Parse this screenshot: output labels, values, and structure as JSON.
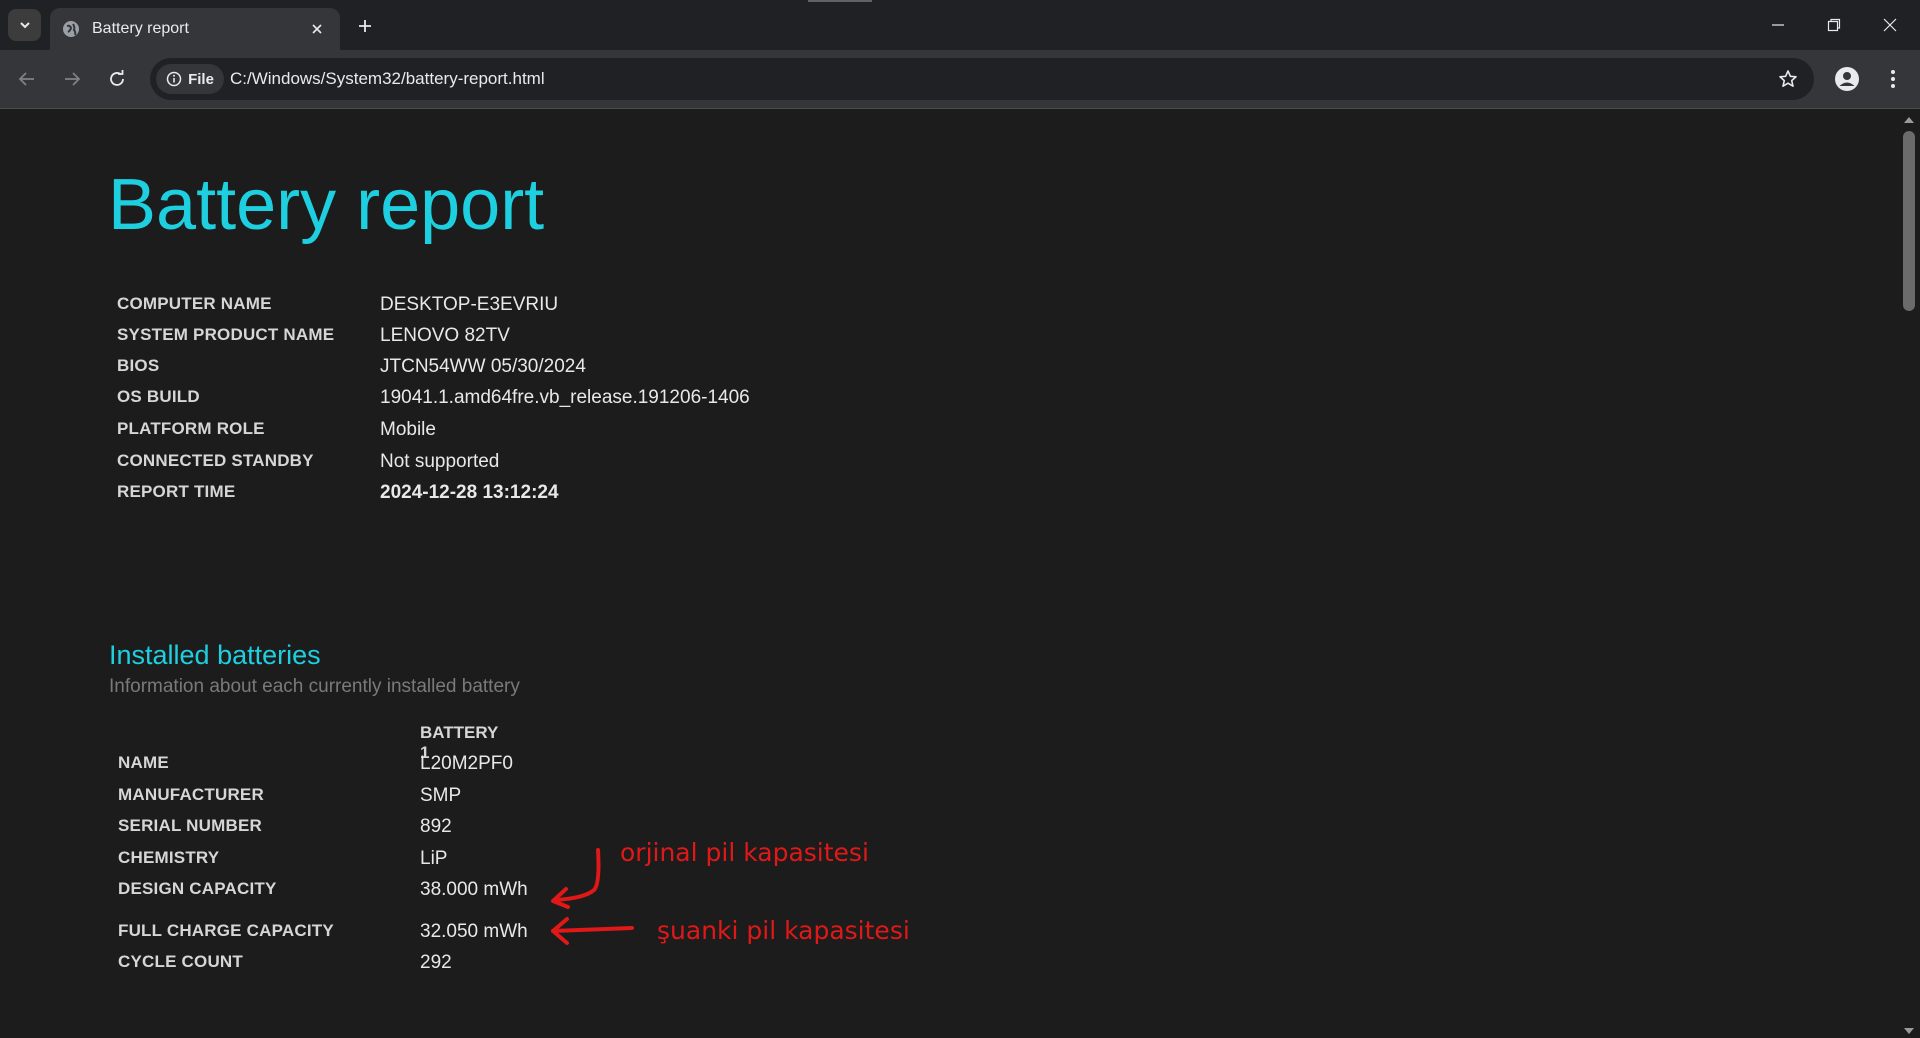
{
  "browser": {
    "tab_title": "Battery report",
    "url": "C:/Windows/System32/battery-report.html",
    "chip_label": "File"
  },
  "report": {
    "title": "Battery report",
    "info": [
      {
        "label": "COMPUTER NAME",
        "value": "DESKTOP-E3EVRIU"
      },
      {
        "label": "SYSTEM PRODUCT NAME",
        "value": "LENOVO 82TV"
      },
      {
        "label": "BIOS",
        "value": "JTCN54WW 05/30/2024"
      },
      {
        "label": "OS BUILD",
        "value": "19041.1.amd64fre.vb_release.191206-1406"
      },
      {
        "label": "PLATFORM ROLE",
        "value": "Mobile"
      },
      {
        "label": "CONNECTED STANDBY",
        "value": "Not supported"
      },
      {
        "label": "REPORT TIME",
        "value": "2024-12-28  13:12:24"
      }
    ],
    "batteries": {
      "title": "Installed batteries",
      "subtitle": "Information about each currently installed battery",
      "column": "BATTERY 1",
      "rows": [
        {
          "label": "NAME",
          "value": "L20M2PF0"
        },
        {
          "label": "MANUFACTURER",
          "value": "SMP"
        },
        {
          "label": "SERIAL NUMBER",
          "value": "892"
        },
        {
          "label": "CHEMISTRY",
          "value": "LiP"
        },
        {
          "label": "DESIGN CAPACITY",
          "value": "38.000 mWh"
        },
        {
          "label": "FULL CHARGE CAPACITY",
          "value": "32.050 mWh"
        },
        {
          "label": "CYCLE COUNT",
          "value": "292"
        }
      ]
    }
  },
  "annotations": {
    "design_note": "orjinal pil kapasitesi",
    "full_note": "şuanki pil kapasitesi",
    "color": "#e01818"
  },
  "colors": {
    "accent": "#1ecfe0",
    "background": "#1c1c1c"
  }
}
